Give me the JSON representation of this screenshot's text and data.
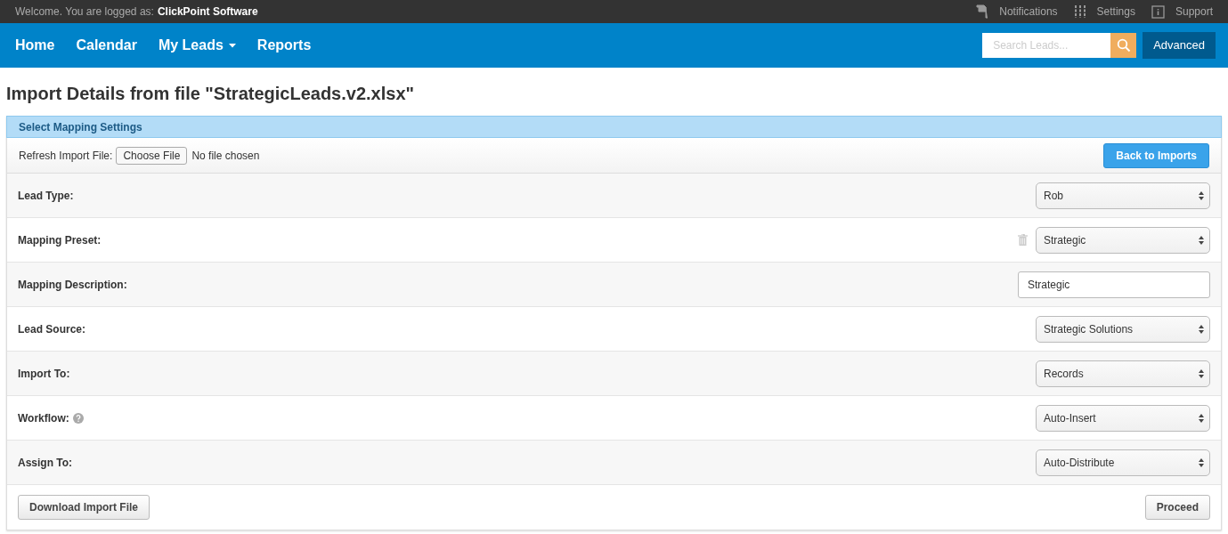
{
  "top_bar": {
    "welcome": "Welcome. You are logged as:",
    "user": "ClickPoint Software",
    "links": [
      {
        "kind": "flag",
        "label": "Notifications"
      },
      {
        "kind": "sliders",
        "label": "Settings"
      },
      {
        "kind": "info",
        "label": "Support"
      }
    ]
  },
  "nav": {
    "items": [
      {
        "label": "Home",
        "dropdown": false
      },
      {
        "label": "Calendar",
        "dropdown": false
      },
      {
        "label": "My Leads",
        "dropdown": true
      },
      {
        "label": "Reports",
        "dropdown": false
      }
    ],
    "search": {
      "placeholder": "Search Leads..."
    },
    "advanced_button": "Advanced"
  },
  "page_title": "Import Details from file \"StrategicLeads.v2.xlsx\"",
  "panel": {
    "header": "Select Mapping Settings",
    "file_label": "Refresh Import File:",
    "choose_button": "Choose File",
    "file_status": "No file chosen",
    "back_button": "Back to Imports",
    "rows": [
      {
        "label": "Lead Type:",
        "kind": "select",
        "value": "Rob",
        "help": false,
        "deletable": false
      },
      {
        "label": "Mapping Preset:",
        "kind": "select",
        "value": "Strategic",
        "help": false,
        "deletable": true
      },
      {
        "label": "Mapping Description:",
        "kind": "text",
        "value": "Strategic",
        "help": false,
        "deletable": false
      },
      {
        "label": "Lead Source:",
        "kind": "select",
        "value": "Strategic Solutions",
        "help": false,
        "deletable": false
      },
      {
        "label": "Import To:",
        "kind": "select",
        "value": "Records",
        "help": false,
        "deletable": false
      },
      {
        "label": "Workflow:",
        "kind": "select",
        "value": "Auto-Insert",
        "help": true,
        "deletable": false
      },
      {
        "label": "Assign To:",
        "kind": "select",
        "value": "Auto-Distribute",
        "help": false,
        "deletable": false
      }
    ],
    "download_button": "Download Import File",
    "proceed_button": "Proceed"
  }
}
